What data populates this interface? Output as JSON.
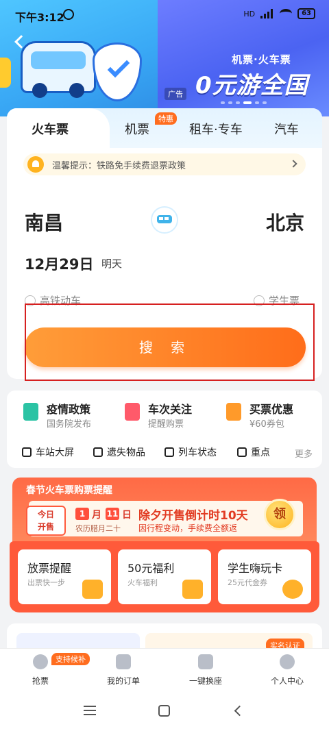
{
  "status": {
    "time": "下午3:12",
    "network": "HD",
    "battery": "63"
  },
  "banner": {
    "subtitle": "机票·火车票",
    "title": "0元游全国",
    "ad_tag": "广告"
  },
  "tabs": [
    {
      "label": "火车票",
      "active": true
    },
    {
      "label": "机票",
      "badge": "特惠"
    },
    {
      "label": "租车·专车"
    },
    {
      "label": "汽车"
    }
  ],
  "notice": {
    "text": "温馨提示：铁路免手续费退票政策"
  },
  "trip": {
    "from": "南昌",
    "to": "北京",
    "date": "12月29日",
    "day": "明天"
  },
  "options": {
    "high_speed": "高铁动车",
    "student": "学生票"
  },
  "search_label": "搜 索",
  "services": [
    {
      "title": "疫情政策",
      "sub": "国务院发布",
      "color": "#2bc3a4"
    },
    {
      "title": "车次关注",
      "sub": "提醒购票",
      "color": "#ff5a6a"
    },
    {
      "title": "买票优惠",
      "sub": "¥60券包",
      "color": "#ff9a2a"
    }
  ],
  "quick": [
    {
      "label": "车站大屏"
    },
    {
      "label": "遗失物品"
    },
    {
      "label": "列车状态"
    },
    {
      "label": "重点"
    }
  ],
  "more_label": "更多",
  "festival": {
    "title": "春节火车票购票提醒",
    "today_line1": "今日",
    "today_line2": "开售",
    "month": "1",
    "month_unit": "月",
    "day": "11",
    "day_unit": "日",
    "lunar": "农历腊月二十",
    "countdown": "除夕开售倒计时10天",
    "countdown_sub": "因行程变动，手续费全额返",
    "claim": "领"
  },
  "fest_cards": [
    {
      "title": "放票提醒",
      "sub": "出票快一步"
    },
    {
      "title": "50元福利",
      "sub": "火车福利"
    },
    {
      "title": "学生嗨玩卡",
      "sub": "25元代金券"
    }
  ],
  "realname_tag": "实名认证",
  "bottom_nav": [
    {
      "label": "抢票",
      "badge": "支持候补"
    },
    {
      "label": "我的订单"
    },
    {
      "label": "一键换座"
    },
    {
      "label": "个人中心"
    }
  ]
}
